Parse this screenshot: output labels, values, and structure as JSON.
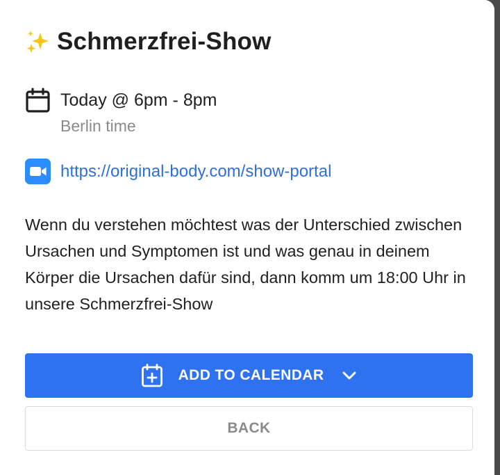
{
  "event": {
    "title": "Schmerzfrei-Show",
    "date_label": "Today @ 6pm - 8pm",
    "timezone_label": "Berlin time",
    "link": "https://original-body.com/show-portal",
    "description": "Wenn du verstehen möchtest was der Unterschied zwischen Ursachen und Symptomen ist und was genau in deinem Körper die Ursachen dafür sind, dann komm um 18:00 Uhr in unsere Schmerzfrei-Show"
  },
  "actions": {
    "add_to_calendar_label": "ADD TO CALENDAR",
    "back_label": "BACK"
  },
  "icons": {
    "title_icon": "sparkles-icon",
    "date_icon": "calendar-icon",
    "link_icon": "video-camera-icon",
    "add_icon": "calendar-plus-icon",
    "dropdown_icon": "chevron-down-icon"
  },
  "colors": {
    "primary": "#2f72ef",
    "link": "#2f6fd8",
    "video_icon": "#2d8cff",
    "sparkle": "#f5c518"
  }
}
